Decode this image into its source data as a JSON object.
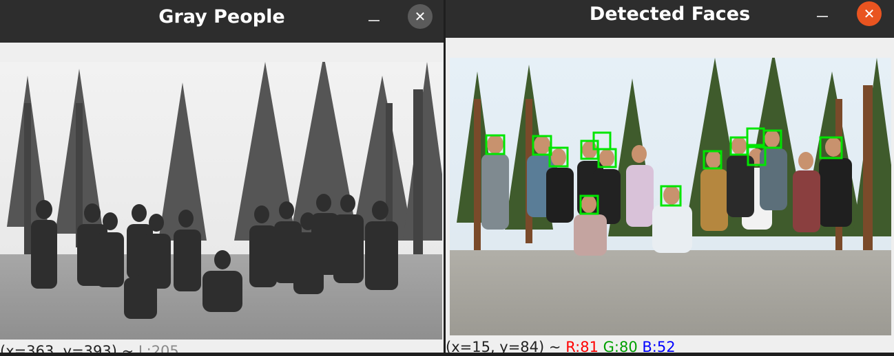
{
  "left_window": {
    "title": "Gray People",
    "status": {
      "coords": "(x=363, y=393) ~",
      "value": "L:205"
    }
  },
  "right_window": {
    "title": "Detected Faces",
    "status": {
      "coords": "(x=15, y=84) ~",
      "r": "R:81",
      "g": "G:80",
      "b": "B:52"
    }
  },
  "colors": {
    "titlebar": "#2d2d2d",
    "close_active": "#e95420",
    "close_inactive": "#5b5b5b",
    "face_box": "#00e600",
    "status_r": "#ff0000",
    "status_g": "#00a000",
    "status_b": "#0000ff",
    "status_l": "#8a8a8a"
  },
  "icons": {
    "minimize": "minimize-icon",
    "close": "close-icon"
  }
}
